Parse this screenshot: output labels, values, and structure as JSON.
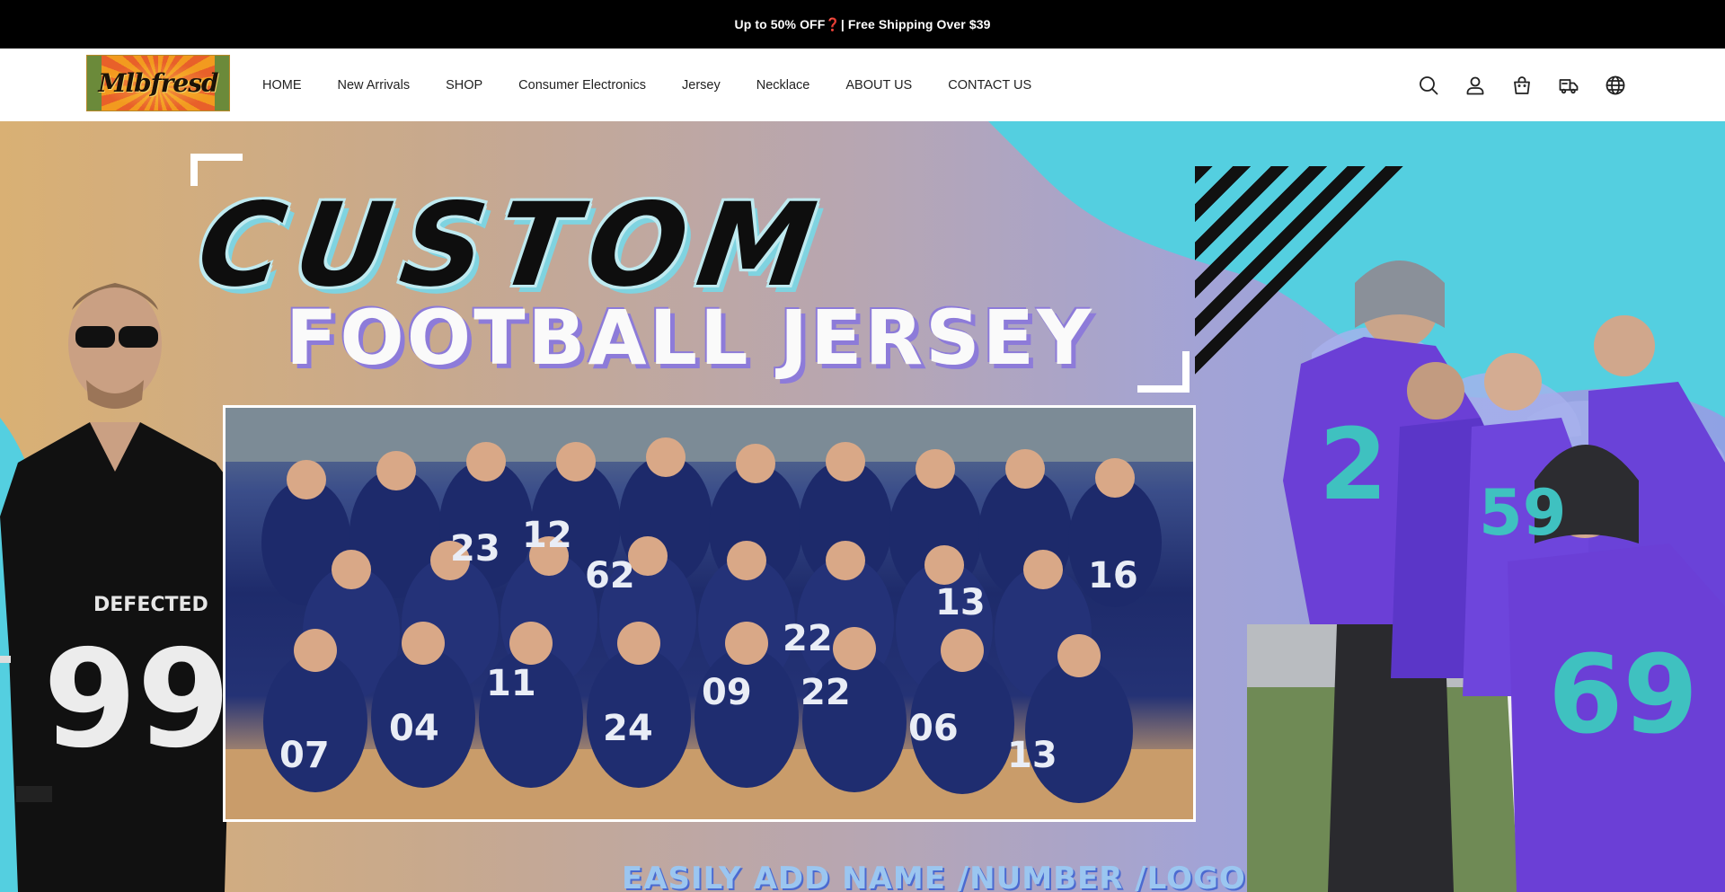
{
  "announcement": {
    "text": "Up to 50% OFF❓| Free Shipping Over $39"
  },
  "header": {
    "logo_text": "Mlbfresd",
    "nav": [
      {
        "label": "HOME"
      },
      {
        "label": "New Arrivals"
      },
      {
        "label": "SHOP"
      },
      {
        "label": "Consumer Electronics"
      },
      {
        "label": "Jersey"
      },
      {
        "label": "Necklace"
      },
      {
        "label": "ABOUT US"
      },
      {
        "label": "CONTACT US"
      }
    ],
    "icons": [
      "search-icon",
      "account-icon",
      "cart-icon",
      "order-tracking-icon",
      "language-globe-icon"
    ]
  },
  "hero": {
    "title_line1": "CUSTOM",
    "title_line2": "FOOTBALL JERSEY",
    "subtitle": "EASILY ADD NAME /NUMBER /LOGO",
    "left_jersey": {
      "team": "DEFECTED",
      "number": "99"
    },
    "team_numbers": [
      "23",
      "22",
      "12",
      "16",
      "04",
      "11",
      "24",
      "09",
      "22",
      "06",
      "13",
      "07",
      "62",
      "13"
    ],
    "right_numbers": [
      "2",
      "59",
      "69"
    ],
    "colors": {
      "teal": "#4fd0e0",
      "navy": "#1d2a6b",
      "purple": "#6b3fd6"
    }
  }
}
